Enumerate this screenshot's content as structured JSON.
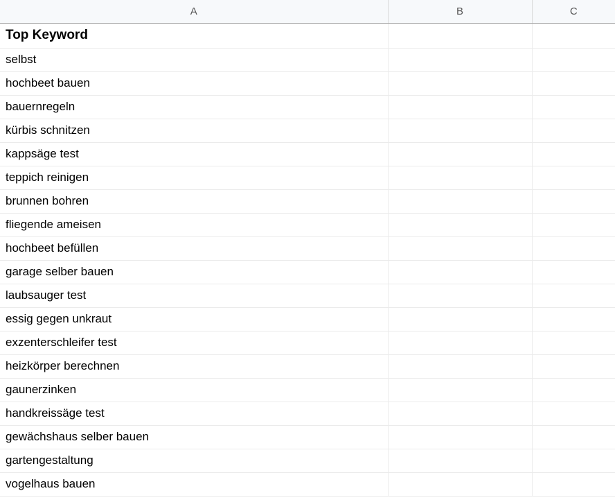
{
  "columns": [
    "A",
    "B",
    "C"
  ],
  "header": "Top Keyword",
  "rows": [
    "selbst",
    "hochbeet bauen",
    "bauernregeln",
    "kürbis schnitzen",
    "kappsäge test",
    "teppich reinigen",
    "brunnen bohren",
    "fliegende ameisen",
    "hochbeet befüllen",
    "garage selber bauen",
    "laubsauger test",
    "essig gegen unkraut",
    "exzenterschleifer test",
    "heizkörper berechnen",
    "gaunerzinken",
    "handkreissäge test",
    "gewächshaus selber bauen",
    "gartengestaltung",
    "vogelhaus bauen"
  ]
}
